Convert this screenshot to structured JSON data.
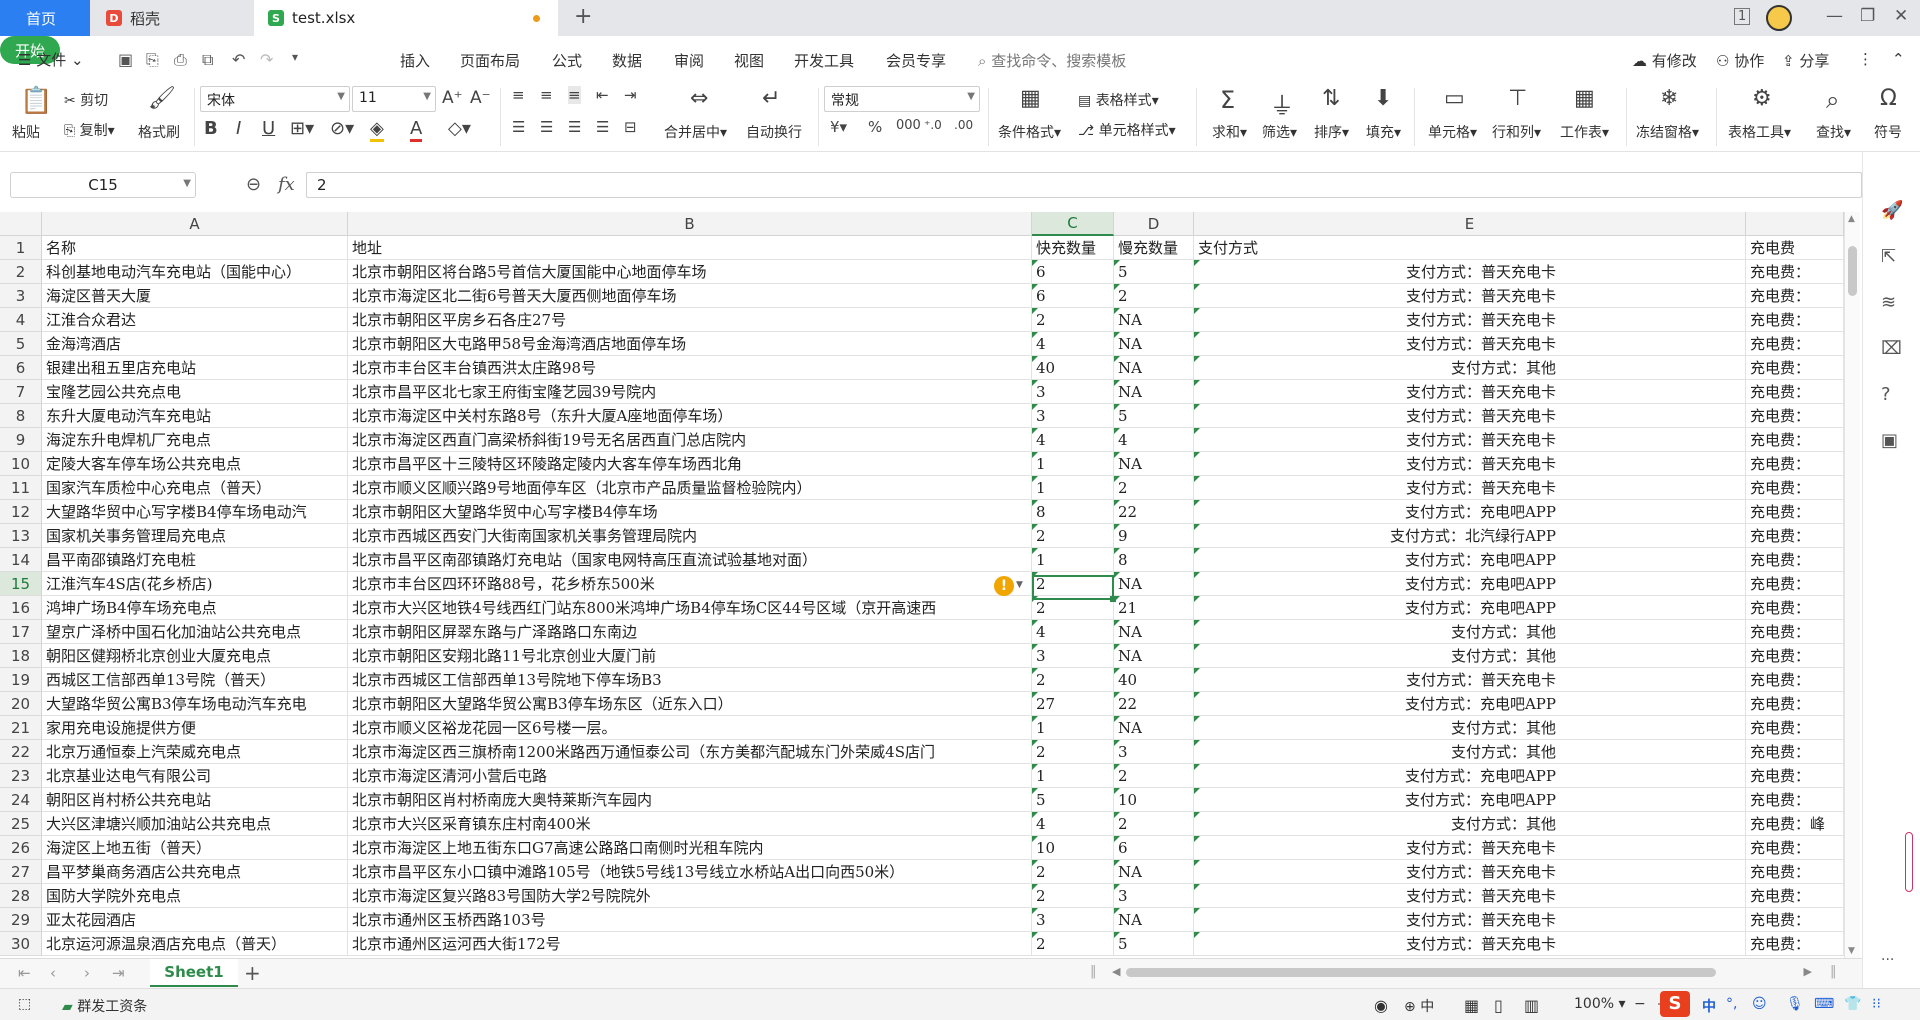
{
  "tabs": {
    "home": "首页",
    "daoke": "稻壳",
    "file": "test.xlsx",
    "add": "+"
  },
  "menu": {
    "file": "文件",
    "items": [
      "开始",
      "插入",
      "页面布局",
      "公式",
      "数据",
      "审阅",
      "视图",
      "开发工具",
      "会员专享"
    ],
    "search_placeholder": "查找命令、搜索模板",
    "modified": "有修改",
    "collab": "协作",
    "share": "分享"
  },
  "ribbon": {
    "paste": "粘贴",
    "cut": "剪切",
    "copy": "复制",
    "format_painter": "格式刷",
    "font_name": "宋体",
    "font_size": "11",
    "merge_center": "合并居中",
    "wrap": "自动换行",
    "number_format": "常规",
    "conditional_format": "条件格式",
    "table_style": "表格样式",
    "cell_style": "单元格样式",
    "sum": "求和",
    "filter": "筛选",
    "sort": "排序",
    "fill": "填充",
    "cell": "单元格",
    "rowcol": "行和列",
    "worksheet": "工作表",
    "freeze": "冻结窗格",
    "table_tools": "表格工具",
    "find": "查找",
    "symbol": "符号"
  },
  "formula_bar": {
    "name_box": "C15",
    "fx": "fx",
    "value": "2"
  },
  "columns": [
    "A",
    "B",
    "C",
    "D",
    "E"
  ],
  "header_row": {
    "rownum": "1",
    "name": "名称",
    "address": "地址",
    "fast": "快充数量",
    "slow": "慢充数量",
    "pay": "支付方式",
    "fee": "充电费"
  },
  "rows": [
    {
      "n": "2",
      "a": "科创基地电动汽车充电站（国能中心）",
      "b": "北京市朝阳区将台路5号首信大厦国能中心地面停车场",
      "c": "6",
      "d": "5",
      "e": "支付方式：普天充电卡",
      "f": "充电费："
    },
    {
      "n": "3",
      "a": "海淀区普天大厦",
      "b": "北京市海淀区北二街6号普天大厦西侧地面停车场",
      "c": "6",
      "d": "2",
      "e": "支付方式：普天充电卡",
      "f": "充电费："
    },
    {
      "n": "4",
      "a": "江淮合众君达",
      "b": "北京市朝阳区平房乡石各庄27号",
      "c": "2",
      "d": "NA",
      "e": "支付方式：普天充电卡",
      "f": "充电费："
    },
    {
      "n": "5",
      "a": "金海湾酒店",
      "b": "北京市朝阳区大屯路甲58号金海湾酒店地面停车场",
      "c": "4",
      "d": "NA",
      "e": "支付方式：普天充电卡",
      "f": "充电费："
    },
    {
      "n": "6",
      "a": "银建出租五里店充电站",
      "b": "北京市丰台区丰台镇西洪太庄路98号",
      "c": "40",
      "d": "NA",
      "e": "支付方式：其他",
      "f": "充电费："
    },
    {
      "n": "7",
      "a": "宝隆艺园公共充点电",
      "b": "北京市昌平区北七家王府街宝隆艺园39号院内",
      "c": "3",
      "d": "NA",
      "e": "支付方式：普天充电卡",
      "f": "充电费："
    },
    {
      "n": "8",
      "a": "东升大厦电动汽车充电站",
      "b": "北京市海淀区中关村东路8号（东升大厦A座地面停车场）",
      "c": "3",
      "d": "5",
      "e": "支付方式：普天充电卡",
      "f": "充电费："
    },
    {
      "n": "9",
      "a": "海淀东升电焊机厂充电点",
      "b": "北京市海淀区西直门高梁桥斜街19号无名居西直门总店院内",
      "c": "4",
      "d": "4",
      "e": "支付方式：普天充电卡",
      "f": "充电费："
    },
    {
      "n": "10",
      "a": "定陵大客车停车场公共充电点",
      "b": "北京市昌平区十三陵特区环陵路定陵内大客车停车场西北角",
      "c": "1",
      "d": "NA",
      "e": "支付方式：普天充电卡",
      "f": "充电费："
    },
    {
      "n": "11",
      "a": "国家汽车质检中心充电点（普天）",
      "b": "北京市顺义区顺兴路9号地面停车区（北京市产品质量监督检验院内）",
      "c": "1",
      "d": "2",
      "e": "支付方式：普天充电卡",
      "f": "充电费："
    },
    {
      "n": "12",
      "a": "大望路华贸中心写字楼B4停车场电动汽",
      "b": "北京市朝阳区大望路华贸中心写字楼B4停车场",
      "c": "8",
      "d": "22",
      "e": "支付方式：充电吧APP",
      "f": "充电费："
    },
    {
      "n": "13",
      "a": "国家机关事务管理局充电点",
      "b": "北京市西城区西安门大街南国家机关事务管理局院内",
      "c": "2",
      "d": "9",
      "e": "支付方式：北汽绿行APP",
      "f": "充电费："
    },
    {
      "n": "14",
      "a": "昌平南邵镇路灯充电桩",
      "b": "北京市昌平区南邵镇路灯充电站（国家电网特高压直流试验基地对面）",
      "c": "1",
      "d": "8",
      "e": "支付方式：充电吧APP",
      "f": "充电费："
    },
    {
      "n": "15",
      "a": "江淮汽车4S店(花乡桥店)",
      "b": "北京市丰台区四环环路88号，花乡桥东500米",
      "c": "2",
      "d": "NA",
      "e": "支付方式：充电吧APP",
      "f": "充电费："
    },
    {
      "n": "16",
      "a": "鸿坤广场B4停车场充电点",
      "b": "北京市大兴区地铁4号线西红门站东800米鸿坤广场B4停车场C区44号区域（京开高速西",
      "c": "2",
      "d": "21",
      "e": "支付方式：充电吧APP",
      "f": "充电费："
    },
    {
      "n": "17",
      "a": "望京广泽桥中国石化加油站公共充电点",
      "b": "北京市朝阳区屏翠东路与广泽路路口东南边",
      "c": "4",
      "d": "NA",
      "e": "支付方式：其他",
      "f": "充电费："
    },
    {
      "n": "18",
      "a": "朝阳区健翔桥北京创业大厦充电点",
      "b": "北京市朝阳区安翔北路11号北京创业大厦门前",
      "c": "3",
      "d": "NA",
      "e": "支付方式：其他",
      "f": "充电费："
    },
    {
      "n": "19",
      "a": "西城区工信部西单13号院（普天）",
      "b": "北京市西城区工信部西单13号院地下停车场B3",
      "c": "2",
      "d": "40",
      "e": "支付方式：普天充电卡",
      "f": "充电费："
    },
    {
      "n": "20",
      "a": "大望路华贸公寓B3停车场电动汽车充电",
      "b": "北京市朝阳区大望路华贸公寓B3停车场东区（近东入口）",
      "c": "27",
      "d": "22",
      "e": "支付方式：充电吧APP",
      "f": "充电费："
    },
    {
      "n": "21",
      "a": "家用充电设施提供方便",
      "b": "北京市顺义区裕龙花园一区6号楼一层。",
      "c": "1",
      "d": "NA",
      "e": "支付方式：其他",
      "f": "充电费："
    },
    {
      "n": "22",
      "a": "北京万通恒泰上汽荣威充电点",
      "b": "北京市海淀区西三旗桥南1200米路西万通恒泰公司（东方美都汽配城东门外荣威4S店门",
      "c": "2",
      "d": "3",
      "e": "支付方式：其他",
      "f": "充电费："
    },
    {
      "n": "23",
      "a": "北京基业达电气有限公司",
      "b": "北京市海淀区清河小营后屯路",
      "c": "1",
      "d": "2",
      "e": "支付方式：充电吧APP",
      "f": "充电费："
    },
    {
      "n": "24",
      "a": "朝阳区肖村桥公共充电站",
      "b": "北京市朝阳区肖村桥南庞大奥特莱斯汽车园内",
      "c": "5",
      "d": "10",
      "e": "支付方式：充电吧APP",
      "f": "充电费："
    },
    {
      "n": "25",
      "a": "大兴区津塘兴顺加油站公共充电点",
      "b": "北京市大兴区采育镇东庄村南400米",
      "c": "4",
      "d": "2",
      "e": "支付方式：其他",
      "f": "充电费：峰"
    },
    {
      "n": "26",
      "a": "海淀区上地五街（普天）",
      "b": "北京市海淀区上地五街东口G7高速公路路口南侧时光租车院内",
      "c": "10",
      "d": "6",
      "e": "支付方式：普天充电卡",
      "f": "充电费："
    },
    {
      "n": "27",
      "a": "昌平梦巢商务酒店公共充电点",
      "b": "北京市昌平区东小口镇中滩路105号（地铁5号线13号线立水桥站A出口向西50米）",
      "c": "2",
      "d": "NA",
      "e": "支付方式：普天充电卡",
      "f": "充电费："
    },
    {
      "n": "28",
      "a": "国防大学院外充电点",
      "b": "北京市海淀区复兴路83号国防大学2号院院外",
      "c": "2",
      "d": "3",
      "e": "支付方式：普天充电卡",
      "f": "充电费："
    },
    {
      "n": "29",
      "a": "亚太花园酒店",
      "b": "北京市通州区玉桥西路103号",
      "c": "3",
      "d": "NA",
      "e": "支付方式：普天充电卡",
      "f": "充电费："
    },
    {
      "n": "30",
      "a": "北京运河源温泉酒店充电点（普天）",
      "b": "北京市通州区运河西大街172号",
      "c": "2",
      "d": "5",
      "e": "支付方式：普天充电卡",
      "f": "充电费："
    }
  ],
  "sheet_tabs": {
    "sheet1": "Sheet1",
    "add": "+"
  },
  "status": {
    "left": "群发工资条",
    "zoom": "100%",
    "ime": "中"
  },
  "colors": {
    "accent_green": "#2e8b4b",
    "home_tab_blue": "#2b7ff0",
    "start_button_green": "#2fa84f",
    "warning_orange": "#ee9a1a"
  }
}
